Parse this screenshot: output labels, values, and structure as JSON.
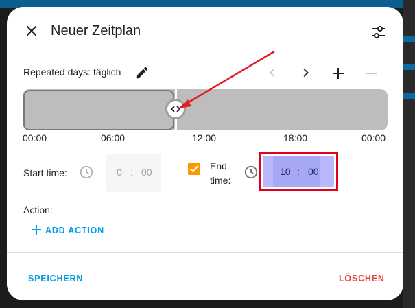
{
  "dialog": {
    "title": "Neuer Zeitplan",
    "close_icon": "close-icon",
    "settings_icon": "tune-icon"
  },
  "schedule": {
    "repeated_days": "Repeated days: täglich",
    "edit_icon": "pencil-icon",
    "nav": [
      "chevron-left-icon",
      "chevron-right-icon",
      "plus-icon",
      "minus-icon"
    ]
  },
  "timeline": {
    "ticks": [
      "00:00",
      "06:00",
      "12:00",
      "18:00",
      "00:00"
    ]
  },
  "start_time": {
    "label": "Start time:",
    "hours": "0",
    "separator": ":",
    "minutes": "00"
  },
  "end_time": {
    "checkbox_checked": true,
    "label_line1": "End",
    "label_line2": "time:",
    "hours": "10",
    "separator": ":",
    "minutes": "00"
  },
  "action": {
    "label": "Action:",
    "add_label": "ADD ACTION"
  },
  "footer": {
    "save": "SPEICHERN",
    "delete": "LÖSCHEN"
  },
  "colors": {
    "accent": "#039be5",
    "danger": "#db4437",
    "checkbox": "#ff9800",
    "highlight": "#e0001a"
  }
}
